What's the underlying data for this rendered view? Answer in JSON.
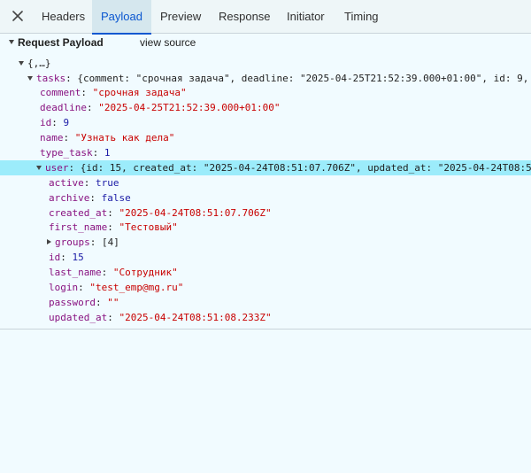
{
  "tabs": [
    {
      "label": "Headers"
    },
    {
      "label": "Payload"
    },
    {
      "label": "Preview"
    },
    {
      "label": "Response"
    },
    {
      "label": "Initiator"
    },
    {
      "label": "Timing"
    }
  ],
  "active_tab": "Payload",
  "section": {
    "title": "Request Payload",
    "view_source": "view source"
  },
  "tree": {
    "root": "{,…}",
    "tasks_key": "tasks",
    "tasks_summary": "{comment: \"срочная задача\", deadline: \"2025-04-25T21:52:39.000+01:00\", id: 9,",
    "comment": {
      "key": "comment",
      "value": "\"срочная задача\""
    },
    "deadline": {
      "key": "deadline",
      "value": "\"2025-04-25T21:52:39.000+01:00\""
    },
    "id": {
      "key": "id",
      "value": "9"
    },
    "name": {
      "key": "name",
      "value": "\"Узнать как дела\""
    },
    "type_task": {
      "key": "type_task",
      "value": "1"
    },
    "user_key": "user",
    "user_summary": "{id: 15, created_at: \"2025-04-24T08:51:07.706Z\", updated_at: \"2025-04-24T08:5",
    "user": {
      "active": {
        "key": "active",
        "value": "true"
      },
      "archive": {
        "key": "archive",
        "value": "false"
      },
      "created_at": {
        "key": "created_at",
        "value": "\"2025-04-24T08:51:07.706Z\""
      },
      "first_name": {
        "key": "first_name",
        "value": "\"Тестовый\""
      },
      "groups": {
        "key": "groups",
        "value": "[4]"
      },
      "id": {
        "key": "id",
        "value": "15"
      },
      "last_name": {
        "key": "last_name",
        "value": "\"Сотрудник\""
      },
      "login": {
        "key": "login",
        "value": "\"test_emp@mg.ru\""
      },
      "password": {
        "key": "password",
        "value": "\"\""
      },
      "updated_at": {
        "key": "updated_at",
        "value": "\"2025-04-24T08:51:08.233Z\""
      }
    }
  },
  "colors": {
    "background": "#f1fbff",
    "tabbar": "#eef6f8",
    "active_tab_bg": "#d5e7ee",
    "active_tab_text": "#0b57d0",
    "selected_row": "#9cecfb",
    "key": "#881280",
    "string": "#c80000",
    "number": "#1a1aa6"
  }
}
